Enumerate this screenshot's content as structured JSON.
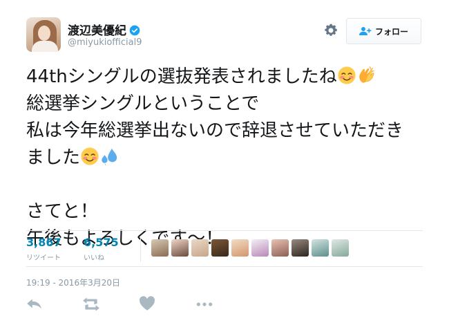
{
  "user": {
    "display_name": "渡辺美優紀",
    "screen_name": "@miyukiofficial9",
    "verified": true
  },
  "follow_button": {
    "label": "フォロー"
  },
  "tweet": {
    "lines": [
      "44thシングルの選抜発表されましたね",
      "総選挙シングルということで",
      "私は今年総選挙出ないので辞退させていただき",
      "ました",
      "さてと！",
      "午後もよろしくです～！"
    ],
    "emoji": [
      "smiling-face-emoji",
      "clapping-hands-emoji",
      "smiling-face-emoji",
      "sweat-droplets-emoji"
    ]
  },
  "stats": {
    "retweets": {
      "count": "3,867",
      "label": "リツイート"
    },
    "likes": {
      "count": "6,575",
      "label": "いいね"
    }
  },
  "likers_count": 10,
  "timestamp": "19:19 - 2016年3月20日",
  "actions": [
    "reply-icon",
    "retweet-icon",
    "like-icon",
    "more-icon"
  ],
  "colors": {
    "link": "#0084b4",
    "muted": "#8899a6",
    "verified": "#1da1f2",
    "divider": "#e1e8ed"
  }
}
